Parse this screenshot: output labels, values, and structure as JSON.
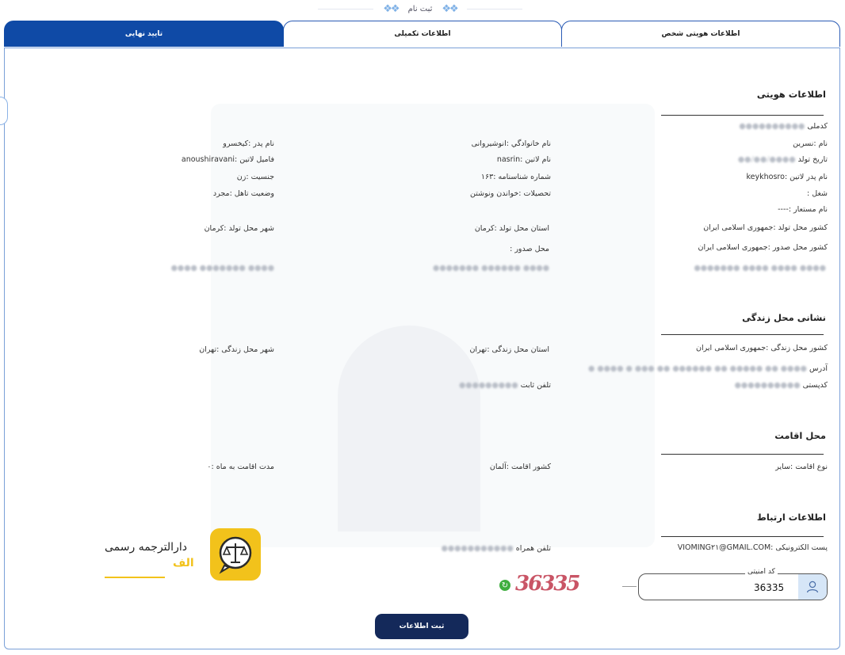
{
  "header": {
    "title": "ثبت نام"
  },
  "tabs": [
    {
      "label": "اطلاعات هویتی شخص"
    },
    {
      "label": "اطلاعات تکمیلی"
    },
    {
      "label": "تایید نهایی"
    }
  ],
  "identity": {
    "title": "اطلاعات هویتی",
    "national_code": {
      "label": "کدملی",
      "value": "●●●●●●●●●●"
    },
    "first_name": "نام :نسرین",
    "birth_date": {
      "label": "تاریخ تولد",
      "value": "●●●●/●●/●●"
    },
    "father_latin": "نام پدر لاتین :keykhosro",
    "job": "شغل :",
    "alias": "نام مستعار :----",
    "birth_country": "کشور محل تولد :جمهوری اسلامی ایران",
    "issue_country": "کشور محل صدور :جمهوری اسلامی ایران",
    "family_name": "نام خانوادگي :انوشیروانی",
    "latin_name": "نام لاتین :nasrin",
    "id_number": "شماره شناسنامه :۱۶۳",
    "education": "تحصیلات :خواندن ونوشتن",
    "birth_province": "استان محل تولد :کرمان",
    "issue_place": "محل صدور :",
    "father_name": "نام پدر :کیخسرو",
    "latin_family": "فامیل لاتین :anoushiravani",
    "gender": "جنسیت :زن",
    "marital": "وضعیت تاهل :مجرد",
    "birth_city": "شهر محل تولد :کرمان",
    "blur_row": [
      "●●●● ●●●● ●●●● ●●●●●●●",
      "●●●● ●●●●●● ●●●●●●●",
      "●●●● ●●●●●●● ●●●●"
    ]
  },
  "residence_address": {
    "title": "نشانی محل زندگی",
    "country": "کشور محل زندگی :جمهوری اسلامی ایران",
    "province": "استان محل زندگی :تهران",
    "city": "شهر محل زندگی :تهران",
    "address": {
      "label": "آدرس",
      "value": "●●●● ●● ●●●●● ●● ●●●●●● ●● ●●● ● ●●●● ●"
    },
    "postal": {
      "label": "کدپستی",
      "value": "●●●●●●●●●●"
    },
    "phone": {
      "label": "تلفن ثابت",
      "value": "●●●●●●●●●"
    }
  },
  "residency": {
    "title": "محل اقامت",
    "type": "نوع اقامت :سایر",
    "country": "کشور اقامت :آلمان",
    "duration": "مدت اقامت به ماه :۰"
  },
  "contact": {
    "title": "اطلاعات ارتباط",
    "email": "پست الکترونیکی :VIOMING۲۱@GMAIL.COM",
    "mobile": {
      "label": "تلفن همراه",
      "value": "●●●●●●●●●●●"
    }
  },
  "security": {
    "label": "کد امنیتی",
    "value": "36335",
    "captcha_text": "36335"
  },
  "submit_label": "ثبت اطلاعات",
  "logo": {
    "name": "دارالترجمه رسمی",
    "sub": "الف"
  },
  "colors": {
    "primary": "#0f4aa6",
    "button": "#14295a",
    "logo": "#f2c21b",
    "captcha": "#c44356"
  }
}
